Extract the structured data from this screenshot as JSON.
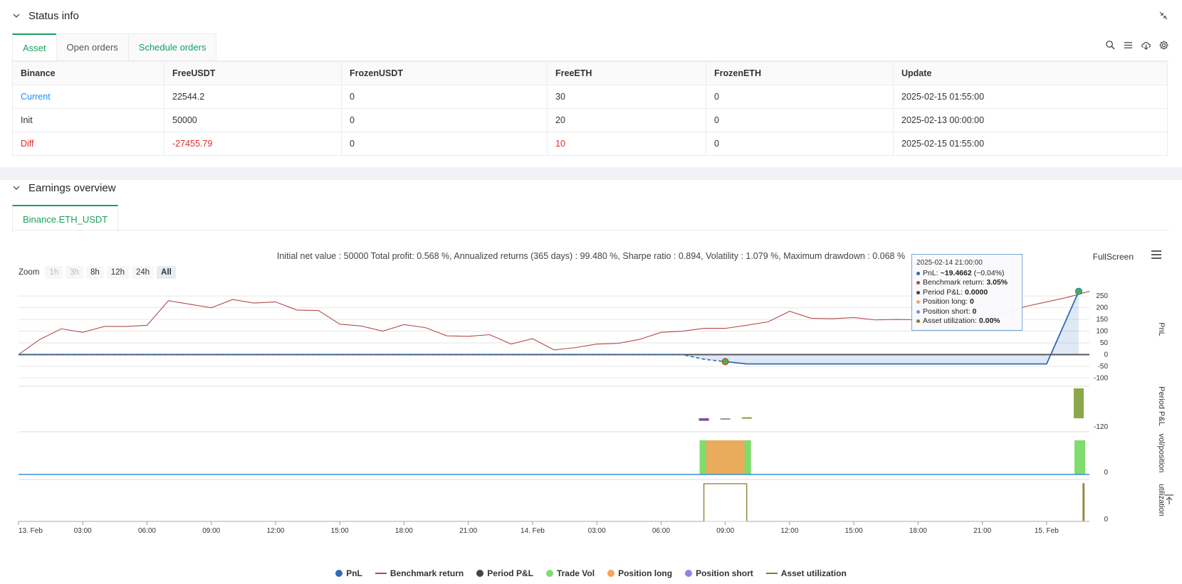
{
  "status_panel": {
    "title": "Status info",
    "tabs": [
      {
        "label": "Asset"
      },
      {
        "label": "Open orders"
      },
      {
        "label": "Schedule orders"
      }
    ],
    "table": {
      "headers": [
        "Binance",
        "FreeUSDT",
        "FrozenUSDT",
        "FreeETH",
        "FrozenETH",
        "Update"
      ],
      "rows": [
        [
          "Current",
          "22544.2",
          "0",
          "30",
          "0",
          "2025-02-15 01:55:00"
        ],
        [
          "Init",
          "50000",
          "0",
          "20",
          "0",
          "2025-02-13 00:00:00"
        ],
        [
          "Diff",
          "-27455.79",
          "0",
          "10",
          "0",
          "2025-02-15 01:55:00"
        ]
      ]
    }
  },
  "earnings_panel": {
    "title": "Earnings overview",
    "tab": "Binance.ETH_USDT",
    "stats": "Initial net value : 50000 Total profit: 0.568 %, Annualized returns (365 days) : 99.480 %, Sharpe ratio : 0.894, Volatility : 1.079 %, Maximum drawdown : 0.068 %",
    "fullscreen_label": "FullScreen",
    "zoom": {
      "label": "Zoom",
      "buttons": [
        "1h",
        "3h",
        "8h",
        "12h",
        "24h",
        "All"
      ],
      "selected": "All"
    },
    "tooltip": {
      "date": "2025-02-14 21:00:00",
      "pnl_label": "PnL:",
      "pnl_value": "~19.4662",
      "pnl_pct": "(~0.04%)",
      "bench_label": "Benchmark return:",
      "bench_value": "3.05%",
      "period_label": "Period P&L:",
      "period_value": "0.0000",
      "long_label": "Position long:",
      "long_value": "0",
      "short_label": "Position short:",
      "short_value": "0",
      "util_label": "Asset utilization:",
      "util_value": "0.00%"
    },
    "legend": [
      {
        "name": "PnL",
        "color": "#2f6db0",
        "style": "dot"
      },
      {
        "name": "Benchmark return",
        "color": "#b24b4b",
        "style": "dash"
      },
      {
        "name": "Period P&L",
        "color": "#444444",
        "style": "dot"
      },
      {
        "name": "Trade Vol",
        "color": "#7fdc6e",
        "style": "dot"
      },
      {
        "name": "Position long",
        "color": "#f5a55a",
        "style": "dot"
      },
      {
        "name": "Position short",
        "color": "#8b86e6",
        "style": "dot"
      },
      {
        "name": "Asset utilization",
        "color": "#8a7a2a",
        "style": "dash"
      }
    ]
  },
  "chart_data": {
    "type": "line",
    "x_tick_labels": [
      "13. Feb",
      "03:00",
      "06:00",
      "09:00",
      "12:00",
      "15:00",
      "18:00",
      "21:00",
      "14. Feb",
      "03:00",
      "06:00",
      "09:00",
      "12:00",
      "15:00",
      "18:00",
      "21:00",
      "15. Feb"
    ],
    "hours": [
      0,
      1,
      2,
      3,
      4,
      5,
      6,
      7,
      8,
      9,
      10,
      11,
      12,
      13,
      14,
      15,
      16,
      17,
      18,
      19,
      20,
      21,
      22,
      23,
      24,
      25,
      26,
      27,
      28,
      29,
      30,
      31,
      32,
      33,
      34,
      35,
      36,
      37,
      38,
      39,
      40,
      41,
      42,
      43,
      44,
      45,
      46,
      47,
      48,
      49
    ],
    "benchmark": [
      0,
      65,
      110,
      95,
      120,
      120,
      125,
      230,
      215,
      200,
      235,
      220,
      225,
      190,
      188,
      130,
      122,
      100,
      128,
      115,
      80,
      78,
      85,
      45,
      68,
      20,
      30,
      45,
      48,
      65,
      95,
      100,
      112,
      112,
      125,
      140,
      185,
      155,
      153,
      158,
      148,
      150,
      148,
      152,
      155,
      160,
      175,
      205,
      225,
      245,
      270
    ],
    "pnl": {
      "x": [
        0,
        31,
        32,
        33,
        34,
        35,
        36,
        37,
        38,
        39,
        40,
        41,
        42,
        43,
        44,
        45,
        46,
        47,
        48,
        49.5
      ],
      "y": [
        0,
        0,
        -20,
        -30,
        -40,
        -40,
        -40,
        -40,
        -40,
        -40,
        -40,
        -40,
        -40,
        -40,
        -40,
        -40,
        -40,
        -40,
        -40,
        270
      ]
    },
    "pnl_axis": {
      "label": "PnL",
      "ticks": [
        250,
        200,
        150,
        100,
        50,
        0,
        -50,
        -100
      ],
      "ylim": [
        -120,
        290
      ]
    },
    "period_pnl": {
      "label": "Period P&L",
      "tick": "-120",
      "bars": [
        {
          "x": 32,
          "value": -10,
          "color": "#7a4aa8"
        },
        {
          "x": 33,
          "value": -4,
          "color": "#999999"
        },
        {
          "x": 34,
          "value": 4,
          "color": "#8a9a3a"
        },
        {
          "x": 49.5,
          "value": 120,
          "color": "#8aa84a"
        }
      ]
    },
    "vol_position": {
      "label": "vol/position",
      "tick": "0",
      "trade_vol": [
        {
          "x0": 31.8,
          "x1": 34.2,
          "value": 1
        },
        {
          "x0": 49.3,
          "x1": 49.8,
          "value": 1
        }
      ],
      "position_long": [
        {
          "x0": 32.1,
          "x1": 33.9,
          "value": 1
        }
      ]
    },
    "utilization": {
      "label": "utilization",
      "tick": "0",
      "segments": [
        {
          "x0": 32,
          "x1": 34,
          "value": 1
        },
        {
          "x0": 49.7,
          "x1": 49.75,
          "value": 1
        }
      ]
    }
  }
}
